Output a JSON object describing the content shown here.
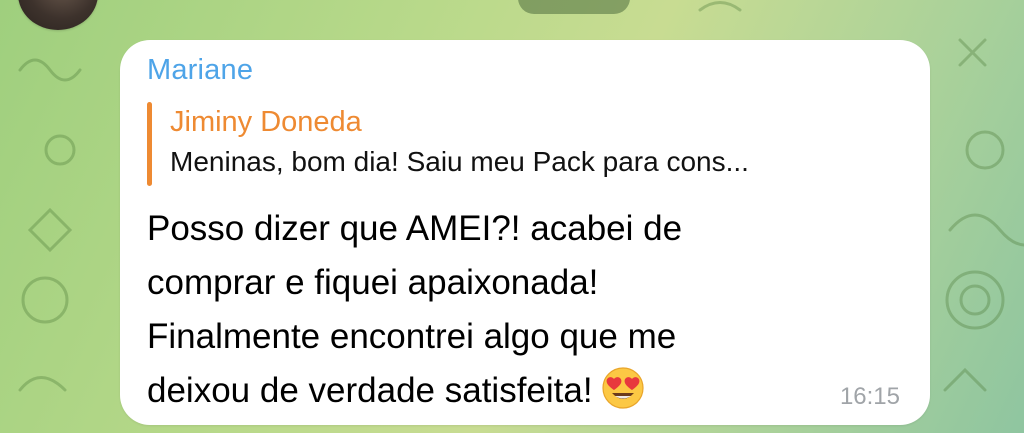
{
  "chat": {
    "sender": "Mariane",
    "reply": {
      "author": "Jiminy Doneda",
      "preview": "Meninas, bom dia! Saiu meu Pack para cons..."
    },
    "message_lines": [
      "Posso dizer que AMEI?! acabei de",
      "comprar e fiquei apaixonada!",
      "Finalmente encontrei algo que me",
      "deixou de verdade satisfeita!"
    ],
    "emoji": "heart-eyes-emoji",
    "time": "16:15"
  },
  "colors": {
    "sender": "#4ea4e8",
    "reply_accent": "#ee8a32",
    "bubble": "#ffffff",
    "time": "#a0a4a8"
  }
}
